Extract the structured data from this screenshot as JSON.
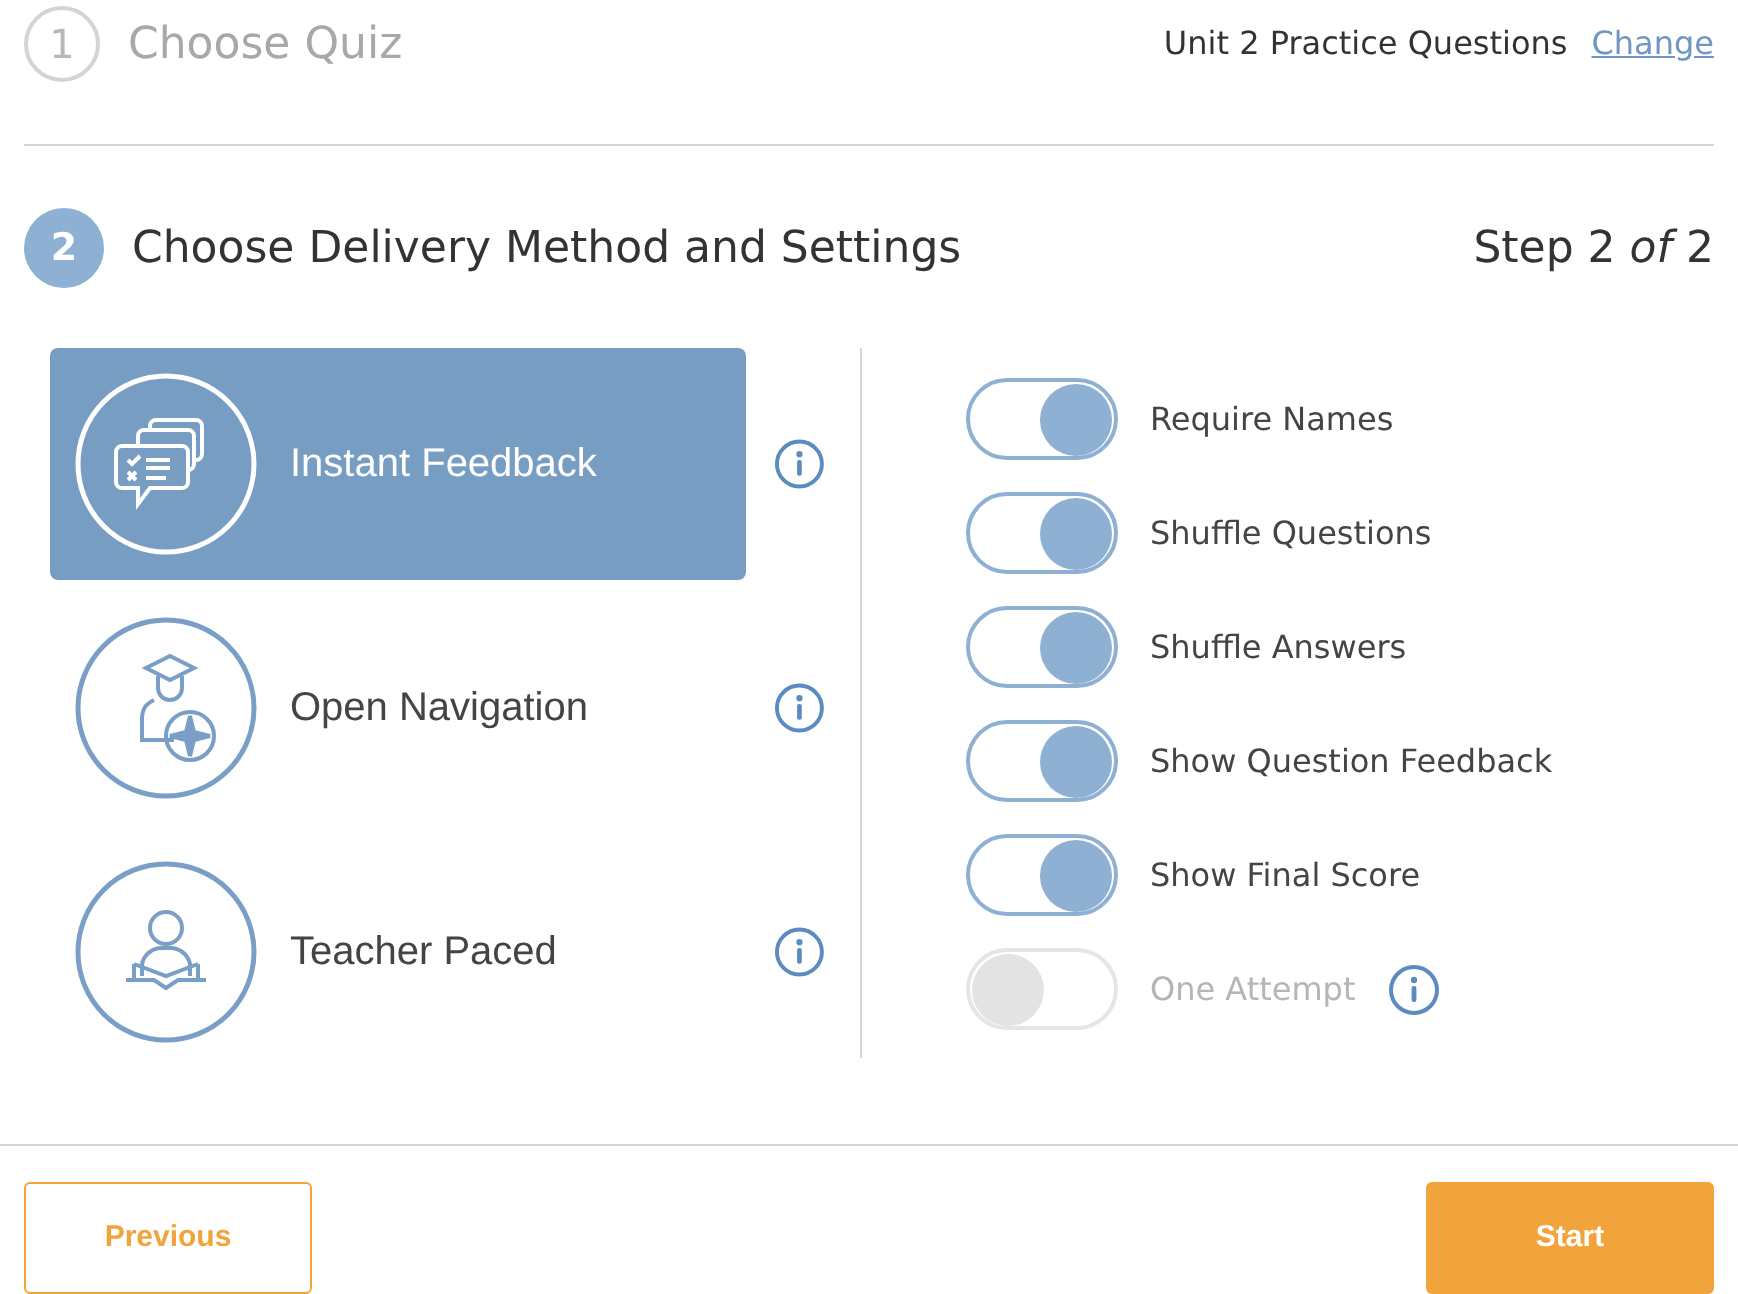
{
  "step1": {
    "number": "1",
    "title": "Choose Quiz",
    "quiz_name": "Unit 2 Practice Questions",
    "change_link": "Change"
  },
  "step2": {
    "number": "2",
    "title": "Choose Delivery Method and Settings",
    "progress": "Step 2 *of* 2"
  },
  "methods": [
    {
      "kind": "feedback",
      "label": "Instant Feedback",
      "selected": true
    },
    {
      "kind": "navigation",
      "label": "Open Navigation",
      "selected": false
    },
    {
      "kind": "teacher",
      "label": "Teacher Paced",
      "selected": false
    }
  ],
  "settings": [
    {
      "label": "Require Names",
      "on": true,
      "disabled": false,
      "info": false
    },
    {
      "label": "Shuffle Questions",
      "on": true,
      "disabled": false,
      "info": false
    },
    {
      "label": "Shuffle Answers",
      "on": true,
      "disabled": false,
      "info": false
    },
    {
      "label": "Show Question Feedback",
      "on": true,
      "disabled": false,
      "info": false
    },
    {
      "label": "Show Final Score",
      "on": true,
      "disabled": false,
      "info": false
    },
    {
      "label": "One Attempt",
      "on": false,
      "disabled": true,
      "info": true
    }
  ],
  "buttons": {
    "previous": "Previous",
    "start": "Start"
  }
}
